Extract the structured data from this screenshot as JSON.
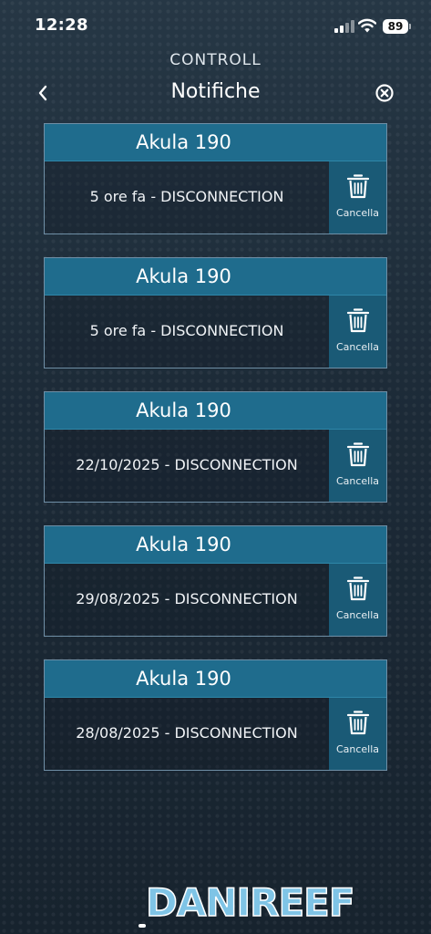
{
  "status_bar": {
    "time": "12:28",
    "battery": "89"
  },
  "app": {
    "brand": "CONTROLL"
  },
  "header": {
    "title": "Notifiche",
    "back_icon": "chevron-left-icon",
    "close_icon": "close-circle-icon"
  },
  "notifications": [
    {
      "device": "Akula 190",
      "message": "5 ore fa - DISCONNECTION",
      "delete_label": "Cancella"
    },
    {
      "device": "Akula 190",
      "message": "5 ore fa - DISCONNECTION",
      "delete_label": "Cancella"
    },
    {
      "device": "Akula 190",
      "message": "22/10/2025 - DISCONNECTION",
      "delete_label": "Cancella"
    },
    {
      "device": "Akula 190",
      "message": "29/08/2025 - DISCONNECTION",
      "delete_label": "Cancella"
    },
    {
      "device": "Akula 190",
      "message": "28/08/2025 - DISCONNECTION",
      "delete_label": "Cancella"
    }
  ],
  "watermark": {
    "text": "DANIREEF"
  },
  "colors": {
    "card_header": "#1f6c8d",
    "delete_button": "#1a5a76",
    "card_border": "#6f8fa6",
    "background": "#1e2d3b"
  }
}
